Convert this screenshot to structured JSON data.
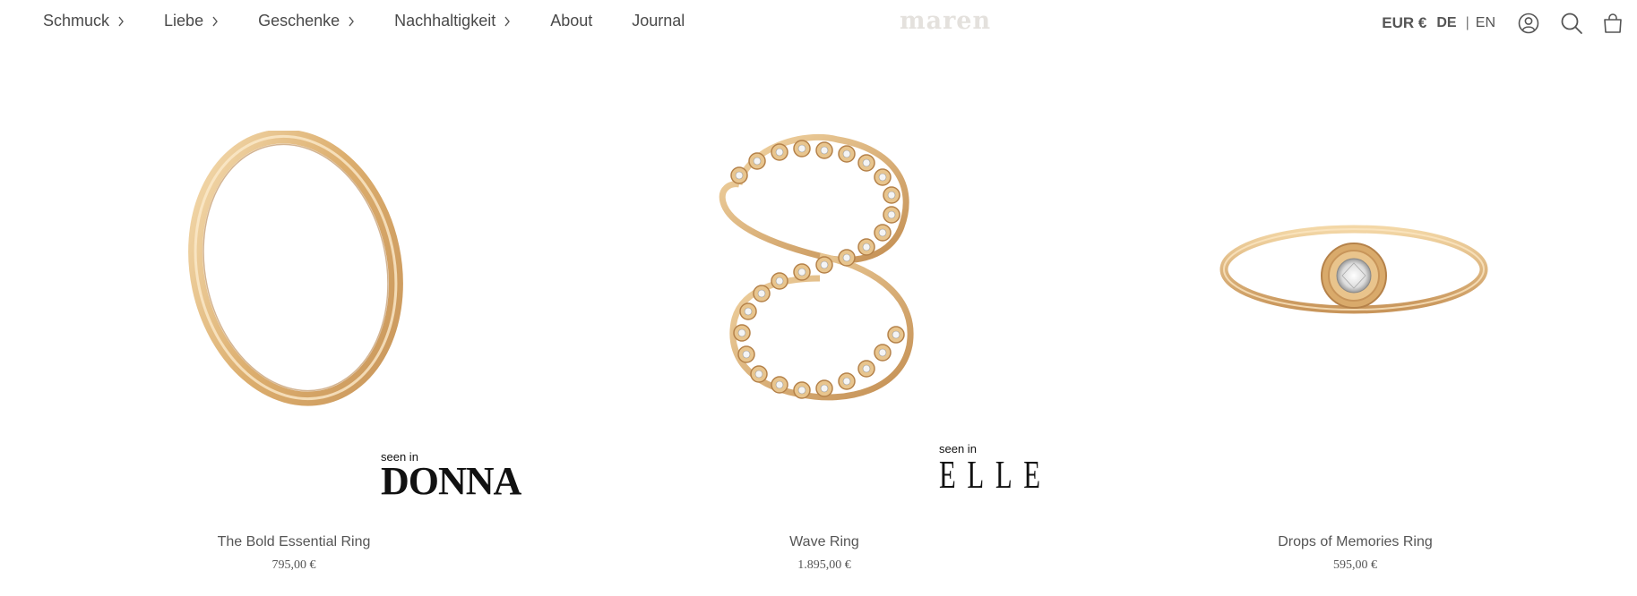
{
  "nav": {
    "items": [
      {
        "label": "Schmuck",
        "has_submenu": true
      },
      {
        "label": "Liebe",
        "has_submenu": true
      },
      {
        "label": "Geschenke",
        "has_submenu": true
      },
      {
        "label": "Nachhaltigkeit",
        "has_submenu": true
      },
      {
        "label": "About",
        "has_submenu": false
      },
      {
        "label": "Journal",
        "has_submenu": false
      }
    ]
  },
  "logo": "maren",
  "header_right": {
    "currency": "EUR €",
    "lang_active": "DE",
    "lang_separator": "|",
    "lang_other": "EN",
    "icons": [
      "account-icon",
      "search-icon",
      "cart-icon"
    ]
  },
  "products": [
    {
      "name": "The Bold Essential Ring",
      "price": "795,00 €",
      "press_seen": "seen in",
      "press_brand": "DONNA",
      "image": "plain-gold-ring"
    },
    {
      "name": "Wave Ring",
      "price": "1.895,00 €",
      "press_seen": "seen in",
      "press_brand": "ELLE",
      "image": "figure-eight-diamond-ring"
    },
    {
      "name": "Drops of Memories Ring",
      "price": "595,00 €",
      "press_seen": "",
      "press_brand": "",
      "image": "solitaire-gold-ring"
    }
  ],
  "colors": {
    "gold_light": "#f3d7a6",
    "gold_mid": "#dcae6e",
    "gold_dark": "#b5824a",
    "text": "#4a4a4a",
    "logo": "#e4e1dd"
  }
}
